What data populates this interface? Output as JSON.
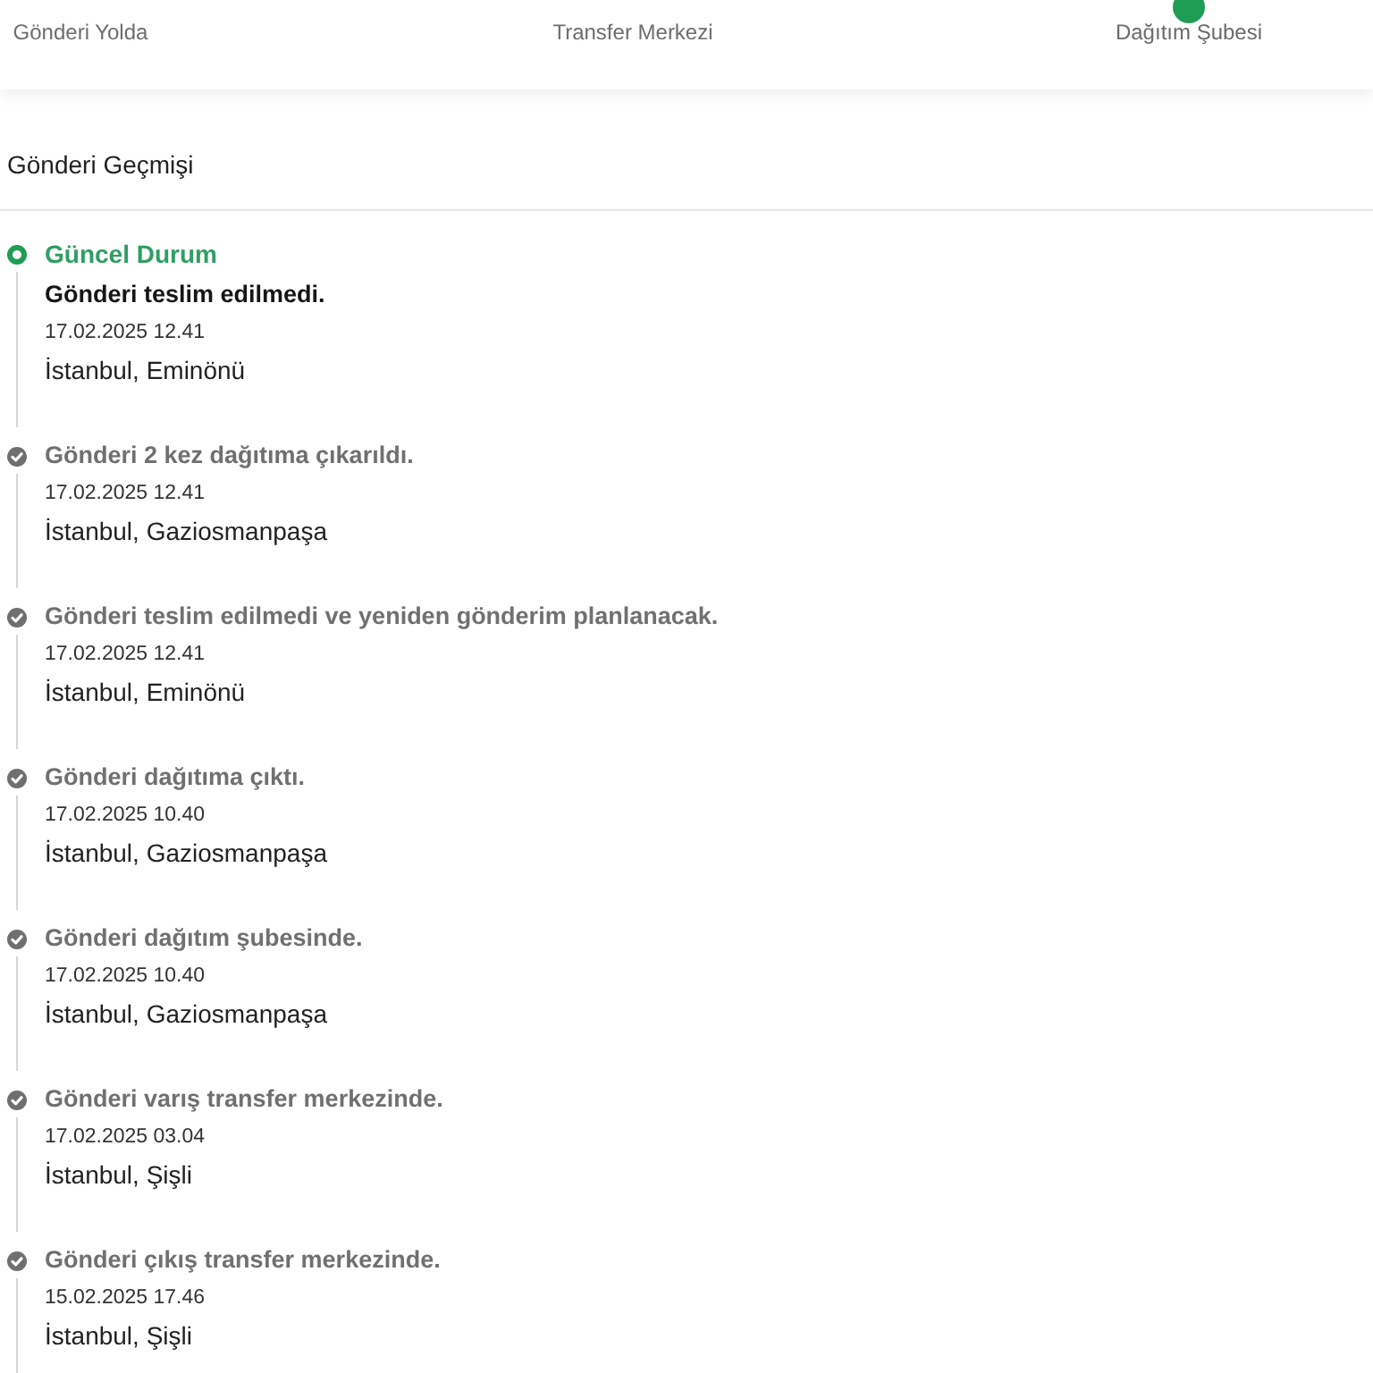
{
  "stepper": {
    "steps": [
      {
        "label": "Gönderi Yolda",
        "active": false
      },
      {
        "label": "Transfer Merkezi",
        "active": false
      },
      {
        "label": "Dağıtım Şubesi",
        "active": true
      }
    ]
  },
  "history": {
    "title": "Gönderi Geçmişi",
    "events": [
      {
        "kind": "current",
        "heading": "Güncel Durum",
        "status": "Gönderi teslim edilmedi.",
        "date": "17.02.2025 12.41",
        "location": "İstanbul, Eminönü"
      },
      {
        "kind": "past",
        "status": "Gönderi 2 kez dağıtıma çıkarıldı.",
        "date": "17.02.2025 12.41",
        "location": "İstanbul, Gaziosmanpaşa"
      },
      {
        "kind": "past",
        "status": "Gönderi teslim edilmedi ve yeniden gönderim planlanacak.",
        "date": "17.02.2025 12.41",
        "location": "İstanbul, Eminönü"
      },
      {
        "kind": "past",
        "status": "Gönderi dağıtıma çıktı.",
        "date": "17.02.2025 10.40",
        "location": "İstanbul, Gaziosmanpaşa"
      },
      {
        "kind": "past",
        "status": "Gönderi dağıtım şubesinde.",
        "date": "17.02.2025 10.40",
        "location": "İstanbul, Gaziosmanpaşa"
      },
      {
        "kind": "past",
        "status": "Gönderi varış transfer merkezinde.",
        "date": "17.02.2025 03.04",
        "location": "İstanbul, Şişli"
      },
      {
        "kind": "past",
        "status": "Gönderi çıkış transfer merkezinde.",
        "date": "15.02.2025 17.46",
        "location": "İstanbul, Şişli"
      }
    ]
  }
}
